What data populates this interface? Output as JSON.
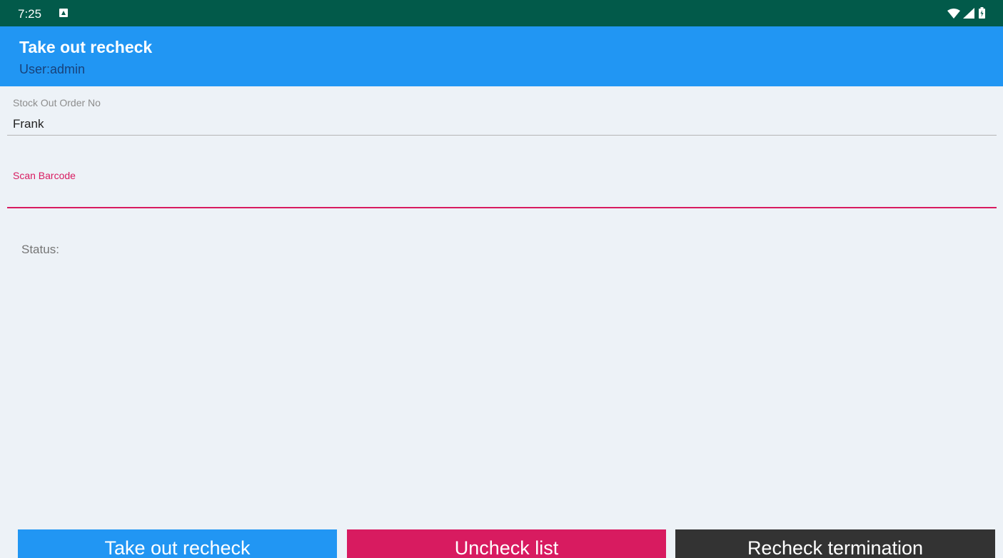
{
  "status_bar": {
    "time": "7:25",
    "notification_icon": "android-notification-icon",
    "icons": [
      "wifi-icon",
      "signal-icon",
      "battery-charging-icon"
    ],
    "color": "#025a4a"
  },
  "app_bar": {
    "title": "Take out recheck",
    "subtitle": "User:admin",
    "color": "#2196f3"
  },
  "form": {
    "order_no": {
      "label": "Stock Out Order No",
      "value": "Frank"
    },
    "barcode": {
      "label": "Scan Barcode",
      "value": "",
      "accent_color": "#d81b60"
    },
    "status_label": "Status:"
  },
  "buttons": {
    "take_out_recheck": "Take out recheck",
    "uncheck_list": "Uncheck list",
    "recheck_termination": "Recheck termination"
  },
  "colors": {
    "background": "#edf2f7",
    "primary": "#2196f3",
    "accent": "#d81b60",
    "dark": "#333333"
  }
}
